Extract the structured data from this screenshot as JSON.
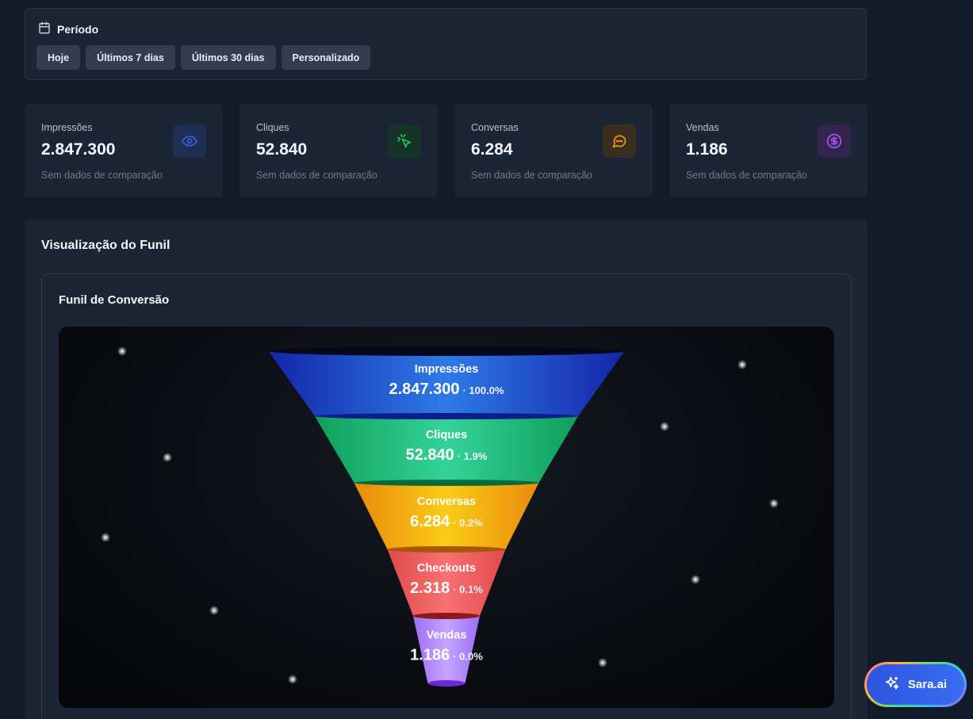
{
  "period": {
    "title": "Período",
    "options": [
      "Hoje",
      "Últimos 7 dias",
      "Últimos 30 dias",
      "Personalizado"
    ]
  },
  "stats": [
    {
      "label": "Impressões",
      "value": "2.847.300",
      "sub": "Sem dados de comparação",
      "icon": "eye-icon",
      "color": "#3b5fe0",
      "bg": "#1f2f54"
    },
    {
      "label": "Cliques",
      "value": "52.840",
      "sub": "Sem dados de comparação",
      "icon": "cursor-click-icon",
      "color": "#22c55e",
      "bg": "#163327"
    },
    {
      "label": "Conversas",
      "value": "6.284",
      "sub": "Sem dados de comparação",
      "icon": "message-circle-icon",
      "color": "#f59e0b",
      "bg": "#3a2e1f"
    },
    {
      "label": "Vendas",
      "value": "1.186",
      "sub": "Sem dados de comparação",
      "icon": "dollar-circle-icon",
      "color": "#a855f7",
      "bg": "#33244f"
    }
  ],
  "section_title": "Visualização do Funil",
  "funnel_title": "Funil de Conversão",
  "funnel": [
    {
      "label": "Impressões",
      "value": "2.847.300",
      "pct": "· 100.0%",
      "top": "#2f7ae8",
      "bot": "#1326a8",
      "edge": "#0e1c8c"
    },
    {
      "label": "Cliques",
      "value": "52.840",
      "pct": "· 1.9%",
      "top": "#34d399",
      "bot": "#0f9f5a",
      "edge": "#066b3a"
    },
    {
      "label": "Conversas",
      "value": "6.284",
      "pct": "· 0.2%",
      "top": "#facc15",
      "bot": "#ea8a0c",
      "edge": "#a85605"
    },
    {
      "label": "Checkouts",
      "value": "2.318",
      "pct": "· 0.1%",
      "top": "#f87171",
      "bot": "#e04b4b",
      "edge": "#8e1717"
    },
    {
      "label": "Vendas",
      "value": "1.186",
      "pct": "· 0.0%",
      "top": "#c4a5ff",
      "bot": "#9d6cf6",
      "edge": "#6d28d9"
    }
  ],
  "assistant": {
    "label": "Sara.ai",
    "icon": "sparkles-icon"
  }
}
